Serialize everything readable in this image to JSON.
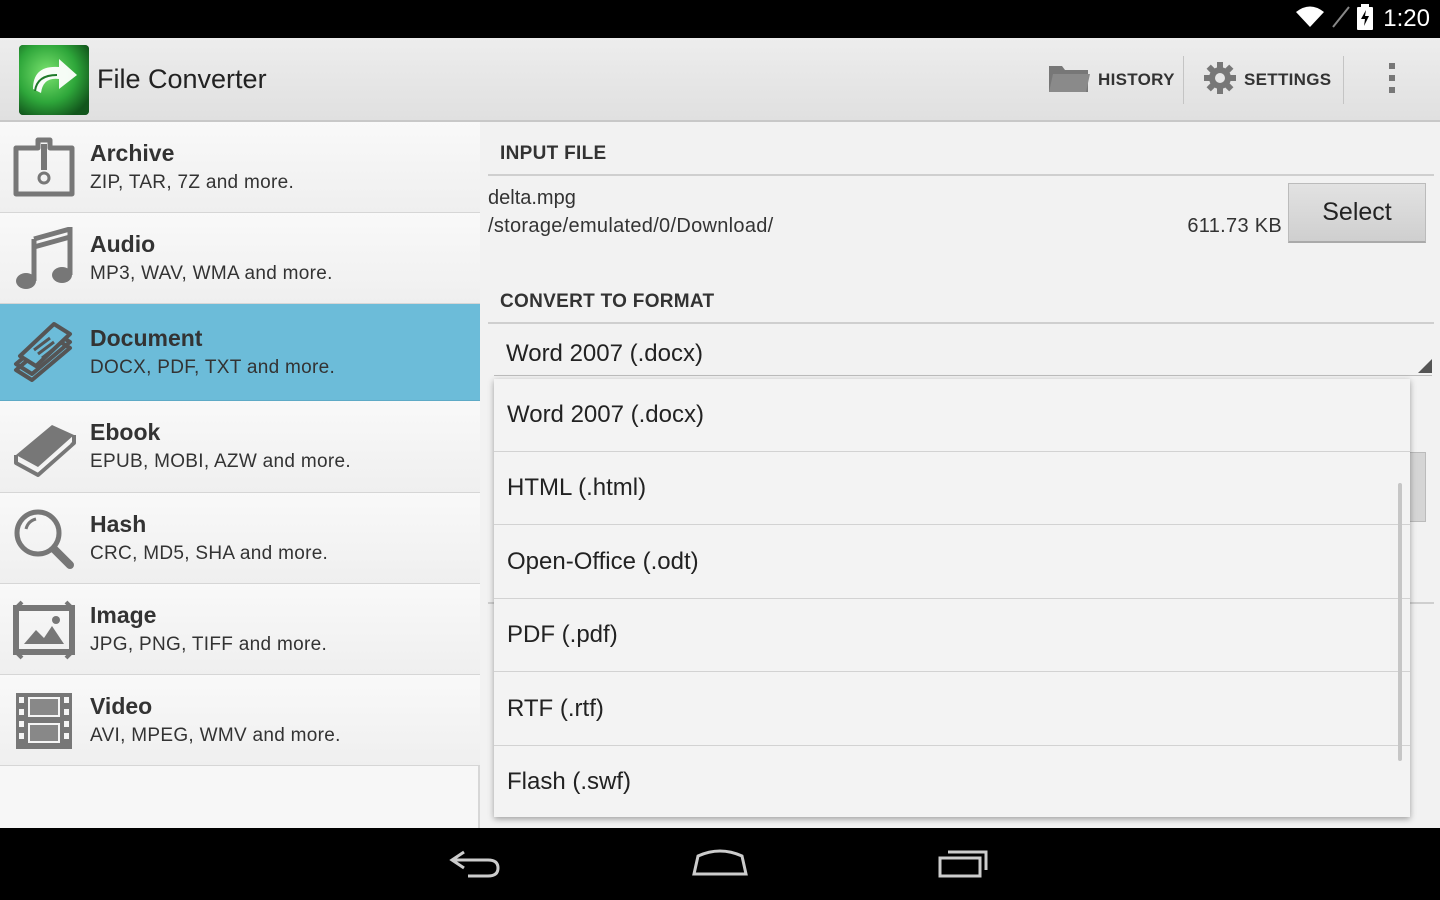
{
  "status_bar": {
    "time": "1:20",
    "icons": [
      "wifi-icon",
      "battery-charging-icon"
    ]
  },
  "action_bar": {
    "app_icon": "refresh-arrow-icon",
    "title": "File Converter",
    "history_label": "HISTORY",
    "history_icon": "folder-icon",
    "settings_label": "SETTINGS",
    "settings_icon": "gear-icon",
    "overflow_icon": "overflow-menu-icon"
  },
  "sidebar": {
    "items": [
      {
        "title": "Archive",
        "subtitle": "ZIP, TAR, 7Z and more.",
        "icon": "archive-zipper-icon",
        "selected": false
      },
      {
        "title": "Audio",
        "subtitle": "MP3, WAV, WMA and more.",
        "icon": "music-note-icon",
        "selected": false
      },
      {
        "title": "Document",
        "subtitle": "DOCX, PDF, TXT and more.",
        "icon": "document-pages-icon",
        "selected": true
      },
      {
        "title": "Ebook",
        "subtitle": "EPUB, MOBI, AZW and more.",
        "icon": "book-icon",
        "selected": false
      },
      {
        "title": "Hash",
        "subtitle": "CRC, MD5, SHA and more.",
        "icon": "magnifier-icon",
        "selected": false
      },
      {
        "title": "Image",
        "subtitle": "JPG, PNG, TIFF and more.",
        "icon": "picture-frame-icon",
        "selected": false
      },
      {
        "title": "Video",
        "subtitle": "AVI, MPEG, WMV and more.",
        "icon": "film-strip-icon",
        "selected": false
      }
    ]
  },
  "input_file": {
    "heading": "INPUT FILE",
    "file_name": "delta.mpg",
    "path": "/storage/emulated/0/Download/",
    "size": "611.73 KB",
    "select_label": "Select"
  },
  "convert": {
    "heading": "CONVERT TO FORMAT",
    "selected_value": "Word 2007 (.docx)",
    "options": [
      "Word 2007 (.docx)",
      "HTML (.html)",
      "Open-Office (.odt)",
      "PDF (.pdf)",
      "RTF (.rtf)",
      "Flash (.swf)"
    ]
  },
  "nav_bar": {
    "icons": [
      "back-icon",
      "home-icon",
      "recent-apps-icon"
    ]
  },
  "colors": {
    "selected_row": "#6cbcd9",
    "action_bar": "#e6e6e6",
    "app_icon_green": "#2ea63a"
  }
}
